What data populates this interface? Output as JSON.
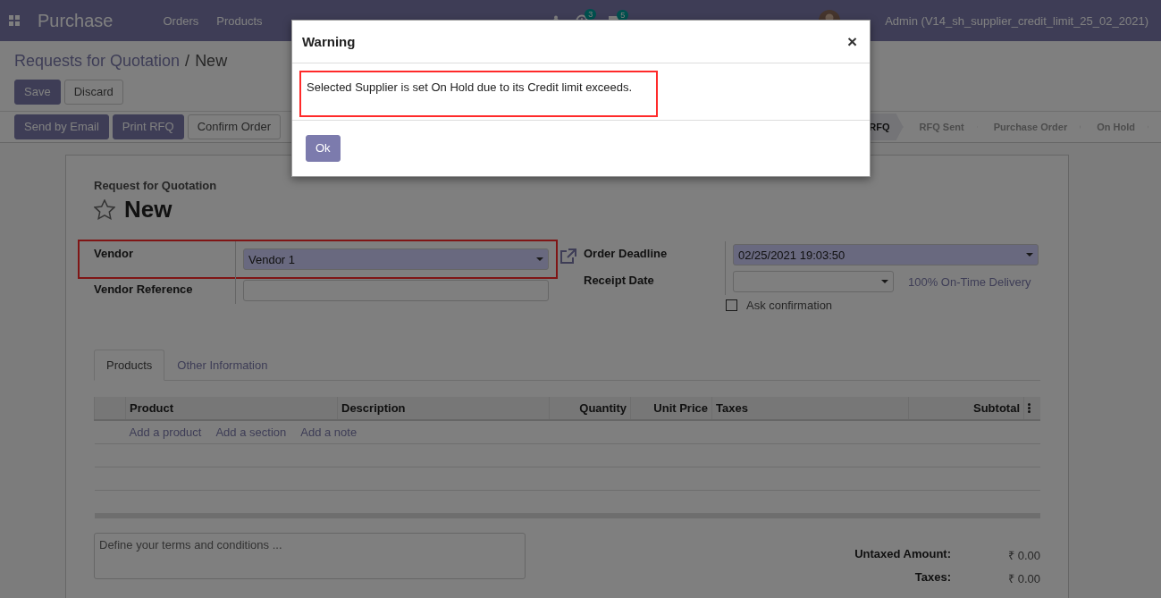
{
  "navbar": {
    "app_name": "Purchase",
    "menu": [
      "Orders",
      "Products"
    ],
    "activity_badge": "3",
    "message_badge": "5",
    "user": "Admin (V14_sh_supplier_credit_limit_25_02_2021)"
  },
  "breadcrumb": {
    "parent": "Requests for Quotation",
    "separator": "/",
    "current": "New"
  },
  "form_buttons": [
    {
      "label": "Save",
      "kind": "primary"
    },
    {
      "label": "Discard",
      "kind": "secondary"
    }
  ],
  "header_buttons": [
    {
      "label": "Send by Email",
      "kind": "primary"
    },
    {
      "label": "Print RFQ",
      "kind": "primary"
    },
    {
      "label": "Confirm Order",
      "kind": "secondary"
    }
  ],
  "status_stages": [
    {
      "label": "RFQ",
      "selected": true
    },
    {
      "label": "RFQ Sent",
      "selected": false
    },
    {
      "label": "Purchase Order",
      "selected": false
    },
    {
      "label": "On Hold",
      "selected": false
    }
  ],
  "sheet": {
    "subtitle": "Request for Quotation",
    "title": "New",
    "favorite": false,
    "left_fields": [
      {
        "label": "Vendor",
        "value": "Vendor 1",
        "kind": "select",
        "required": true,
        "highlighted": true
      },
      {
        "label": "Vendor Reference",
        "kind": "input",
        "required": false,
        "highlighted": false
      }
    ],
    "right_fields": [
      {
        "label": "Order Deadline",
        "value": "02/25/2021 19:03:50",
        "kind": "select",
        "required": true
      },
      {
        "label": "Receipt Date",
        "kind": "select",
        "required": false,
        "link": "100% On-Time Delivery"
      }
    ],
    "ask_confirmation": {
      "label": "Ask confirmation",
      "checked": false
    },
    "tabs": [
      {
        "label": "Products",
        "selected": true
      },
      {
        "label": "Other Information",
        "selected": false
      }
    ],
    "table": {
      "columns": [
        "Product",
        "Description",
        "Quantity",
        "Unit Price",
        "Taxes",
        "Subtotal"
      ],
      "add_links": [
        "Add a product",
        "Add a section",
        "Add a note"
      ]
    },
    "terms": {
      "placeholder": "Define your terms and conditions ..."
    },
    "totals": [
      {
        "label": "Untaxed Amount:",
        "value": "₹ 0.00"
      },
      {
        "label": "Taxes:",
        "value": "₹ 0.00"
      }
    ]
  },
  "dialog": {
    "title": "Warning",
    "close": "×",
    "message": "Selected Supplier is set On Hold due to its Credit limit exceeds.",
    "highlighted": true,
    "button": "Ok"
  }
}
